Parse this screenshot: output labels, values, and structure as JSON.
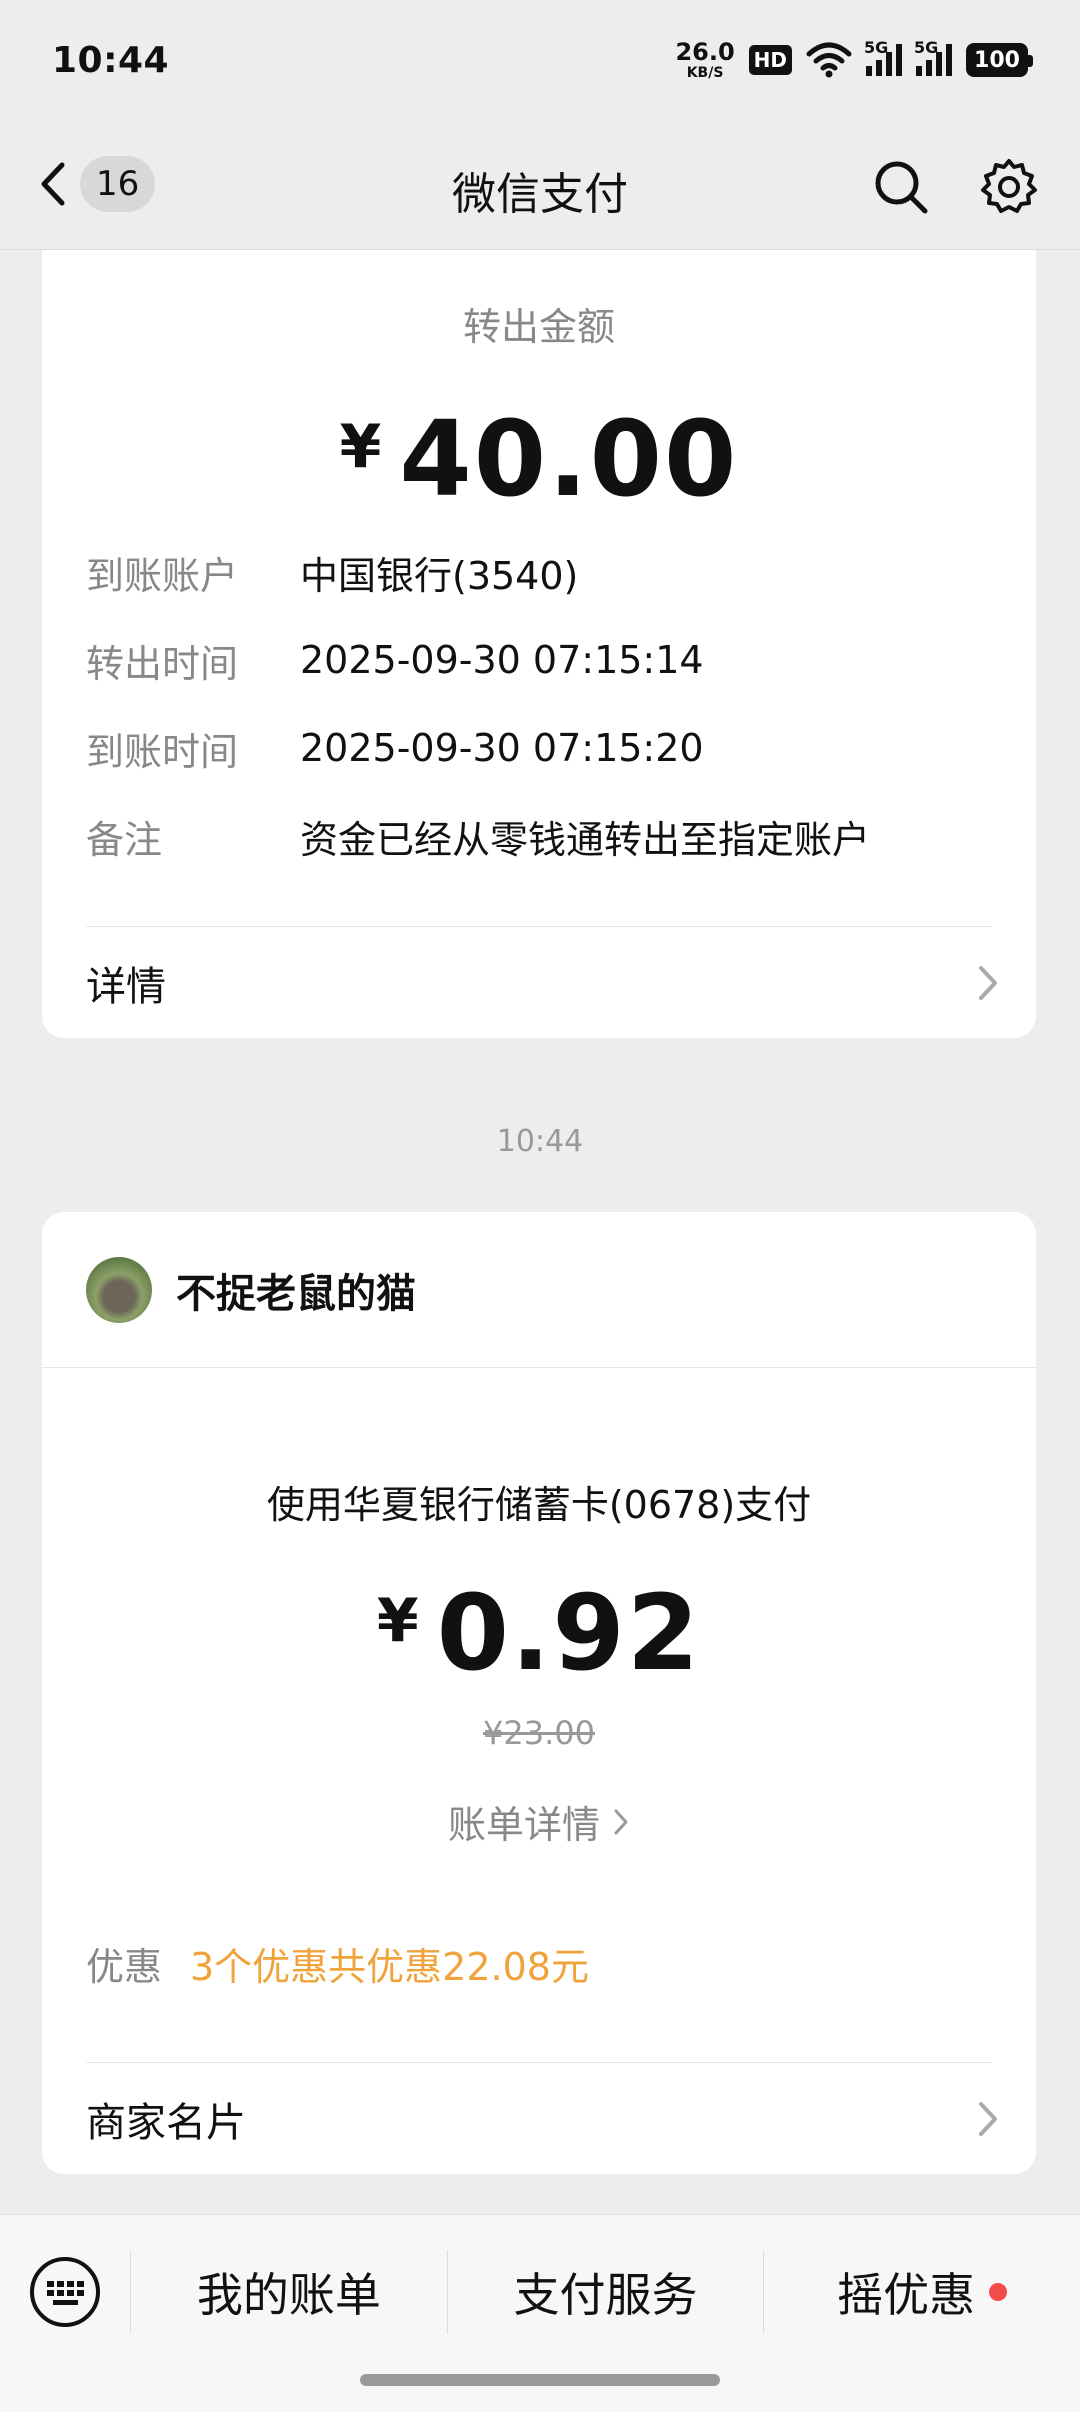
{
  "status_bar": {
    "time": "10:44",
    "net_speed_value": "26.0",
    "net_speed_unit": "KB/S",
    "hd_label": "HD",
    "signal_1_label": "5G",
    "signal_2_label": "5G",
    "battery": "100"
  },
  "nav": {
    "unread_count": "16",
    "title": "微信支付"
  },
  "transfer_card": {
    "amount_label": "转出金额",
    "currency_symbol": "¥",
    "amount": "40.00",
    "rows": [
      {
        "label": "到账账户",
        "value": "中国银行(3540)"
      },
      {
        "label": "转出时间",
        "value": "2025-09-30 07:15:14"
      },
      {
        "label": "到账时间",
        "value": "2025-09-30 07:15:20"
      },
      {
        "label": "备注",
        "value": "资金已经从零钱通转出至指定账户"
      }
    ],
    "details_label": "详情"
  },
  "message_time": "10:44",
  "payment_card": {
    "merchant_name": "不捉老鼠的猫",
    "pay_method": "使用华夏银行储蓄卡(0678)支付",
    "currency_symbol": "¥",
    "amount": "0.92",
    "original_amount": "¥23.00",
    "bill_details_label": "账单详情",
    "promo_label": "优惠",
    "promo_value": "3个优惠共优惠22.08元",
    "merchant_card_label": "商家名片"
  },
  "bottom_menu": {
    "items": [
      "我的账单",
      "支付服务",
      "摇优惠"
    ]
  },
  "colors": {
    "background": "#ededed",
    "promo_orange": "#f0a33a",
    "red_dot": "#f34a4a"
  }
}
